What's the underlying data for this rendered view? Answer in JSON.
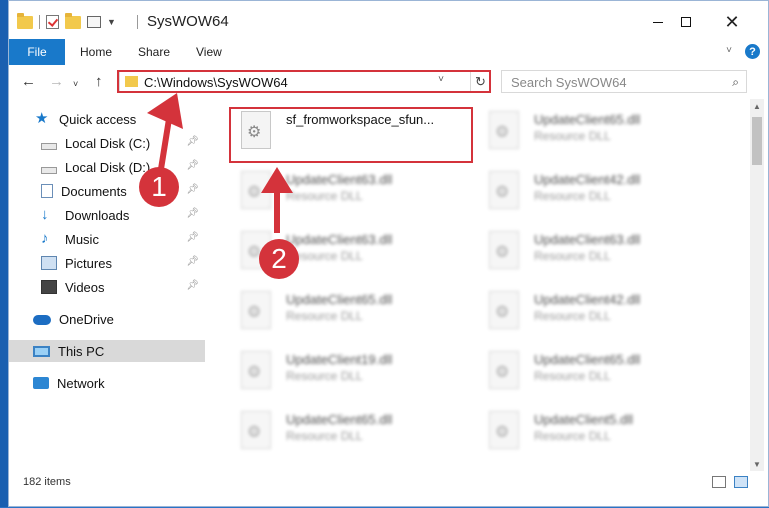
{
  "window": {
    "title": "SysWOW64"
  },
  "ribbon": {
    "tabs": [
      "File",
      "Home",
      "Share",
      "View"
    ]
  },
  "address": {
    "path": "C:\\Windows\\SysWOW64"
  },
  "search": {
    "placeholder": "Search SysWOW64"
  },
  "sidebar": {
    "items": [
      {
        "label": "Quick access",
        "icon": "star-icon"
      },
      {
        "label": "Local Disk (C:)",
        "icon": "drive-icon"
      },
      {
        "label": "Local Disk (D:)",
        "icon": "drive-icon"
      },
      {
        "label": "Documents",
        "icon": "documents-icon"
      },
      {
        "label": "Downloads",
        "icon": "download-icon"
      },
      {
        "label": "Music",
        "icon": "music-icon"
      },
      {
        "label": "Pictures",
        "icon": "pictures-icon"
      },
      {
        "label": "Videos",
        "icon": "videos-icon"
      },
      {
        "label": "OneDrive",
        "icon": "cloud-icon"
      },
      {
        "label": "This PC",
        "icon": "pc-icon"
      },
      {
        "label": "Network",
        "icon": "network-icon"
      }
    ]
  },
  "files": [
    {
      "name": "sf_fromworkspace_sfun...",
      "type": ""
    },
    {
      "name": "UpdateClient65.dll",
      "type": "Resource DLL"
    },
    {
      "name": "UpdateClient63.dll",
      "type": "Resource DLL"
    },
    {
      "name": "UpdateClient42.dll",
      "type": "Resource DLL"
    },
    {
      "name": "UpdateClient63.dll",
      "type": "Resource DLL"
    },
    {
      "name": "UpdateClient63.dll",
      "type": "Resource DLL"
    },
    {
      "name": "UpdateClient65.dll",
      "type": "Resource DLL"
    },
    {
      "name": "UpdateClient42.dll",
      "type": "Resource DLL"
    },
    {
      "name": "UpdateClient19.dll",
      "type": "Resource DLL"
    },
    {
      "name": "UpdateClient65.dll",
      "type": "Resource DLL"
    },
    {
      "name": "UpdateClient65.dll",
      "type": "Resource DLL"
    },
    {
      "name": "UpdateClient5.dll",
      "type": "Resource DLL"
    }
  ],
  "status": {
    "count": "182 items"
  },
  "markers": [
    "1",
    "2"
  ],
  "colors": {
    "accent": "#1979ca",
    "highlight": "#d4333b"
  }
}
